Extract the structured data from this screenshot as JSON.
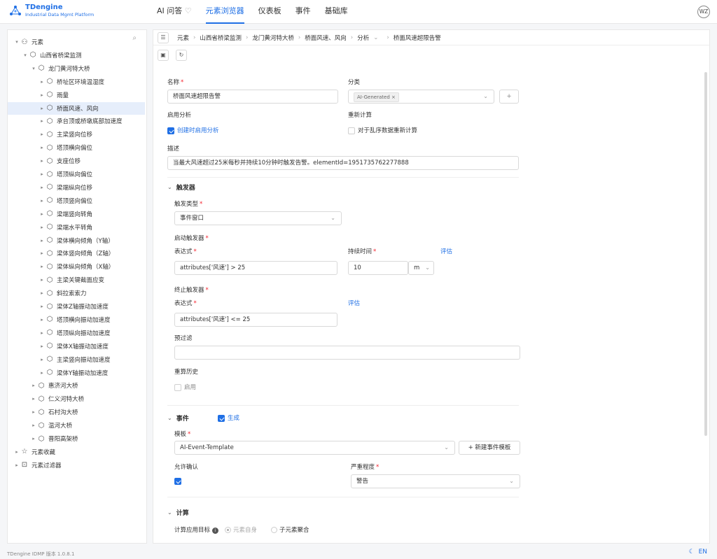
{
  "app": {
    "title": "TDengine",
    "subtitle": "Industrial Data Mgmt Platform",
    "version": "TDengine IDMP 版本 1.0.8.1",
    "lang": "EN",
    "avatar": "WZ"
  },
  "nav": [
    "AI 问答",
    "元素浏览器",
    "仪表板",
    "事件",
    "基础库"
  ],
  "tree": [
    {
      "label": "元素",
      "level": 0,
      "icon": "hierarchy",
      "caret": "▾"
    },
    {
      "label": "山西省桥梁监测",
      "level": 1,
      "icon": "cube",
      "caret": "▾"
    },
    {
      "label": "龙门黄河特大桥",
      "level": 2,
      "icon": "cube",
      "caret": "▾"
    },
    {
      "label": "桥址区环境温湿度",
      "level": 3,
      "icon": "cube",
      "caret": "▸"
    },
    {
      "label": "雨量",
      "level": 3,
      "icon": "cube",
      "caret": "▸"
    },
    {
      "label": "桥面风速、风向",
      "level": 3,
      "icon": "cube",
      "caret": "▸",
      "selected": true
    },
    {
      "label": "承台顶或桥墩底部加速度",
      "level": 3,
      "icon": "cube",
      "caret": "▸"
    },
    {
      "label": "主梁竖向位移",
      "level": 3,
      "icon": "cube",
      "caret": "▸"
    },
    {
      "label": "塔顶横向偏位",
      "level": 3,
      "icon": "cube",
      "caret": "▸"
    },
    {
      "label": "支座位移",
      "level": 3,
      "icon": "cube",
      "caret": "▸"
    },
    {
      "label": "塔顶纵向偏位",
      "level": 3,
      "icon": "cube",
      "caret": "▸"
    },
    {
      "label": "梁端纵向位移",
      "level": 3,
      "icon": "cube",
      "caret": "▸"
    },
    {
      "label": "塔顶竖向偏位",
      "level": 3,
      "icon": "cube",
      "caret": "▸"
    },
    {
      "label": "梁端竖向转角",
      "level": 3,
      "icon": "cube",
      "caret": "▸"
    },
    {
      "label": "梁端水平转角",
      "level": 3,
      "icon": "cube",
      "caret": "▸"
    },
    {
      "label": "梁体横向倾角（Y轴）",
      "level": 3,
      "icon": "cube",
      "caret": "▸"
    },
    {
      "label": "梁体竖向倾角（Z轴）",
      "level": 3,
      "icon": "cube",
      "caret": "▸"
    },
    {
      "label": "梁体纵向倾角（X轴）",
      "level": 3,
      "icon": "cube",
      "caret": "▸"
    },
    {
      "label": "主梁关键截面应变",
      "level": 3,
      "icon": "cube",
      "caret": "▸"
    },
    {
      "label": "斜拉索索力",
      "level": 3,
      "icon": "cube",
      "caret": "▸"
    },
    {
      "label": "梁体Z轴振动加速度",
      "level": 3,
      "icon": "cube",
      "caret": "▸"
    },
    {
      "label": "塔顶横向振动加速度",
      "level": 3,
      "icon": "cube",
      "caret": "▸"
    },
    {
      "label": "塔顶纵向振动加速度",
      "level": 3,
      "icon": "cube",
      "caret": "▸"
    },
    {
      "label": "梁体X轴振动加速度",
      "level": 3,
      "icon": "cube",
      "caret": "▸"
    },
    {
      "label": "主梁竖向振动加速度",
      "level": 3,
      "icon": "cube",
      "caret": "▸"
    },
    {
      "label": "梁体Y轴振动加速度",
      "level": 3,
      "icon": "cube",
      "caret": "▸"
    },
    {
      "label": "惠济河大桥",
      "level": 2,
      "icon": "cube",
      "caret": "▸"
    },
    {
      "label": "仁义河特大桥",
      "level": 2,
      "icon": "cube",
      "caret": "▸"
    },
    {
      "label": "石村沟大桥",
      "level": 2,
      "icon": "cube",
      "caret": "▸"
    },
    {
      "label": "温河大桥",
      "level": 2,
      "icon": "cube",
      "caret": "▸"
    },
    {
      "label": "晋阳高架桥",
      "level": 2,
      "icon": "cube",
      "caret": "▸"
    },
    {
      "label": "元素收藏",
      "level": 0,
      "icon": "star-box",
      "caret": "▸"
    },
    {
      "label": "元素过滤器",
      "level": 0,
      "icon": "filter-box",
      "caret": "▸"
    }
  ],
  "breadcrumb": [
    "元素",
    "山西省桥梁监测",
    "龙门黄河特大桥",
    "桥面风速、风向",
    "分析",
    "桥面风速超限告警"
  ],
  "form": {
    "name_label": "名称",
    "name_value": "桥面风速超限告警",
    "category_label": "分类",
    "category_tag": "AI-Generated",
    "enable_label": "启用分析",
    "enable_check": "创建时启用分析",
    "recalc_label": "重新计算",
    "recalc_check": "对于乱序数据重新计算",
    "desc_label": "描述",
    "desc_value": "当最大风速超过25米每秒并持续10分钟时触发告警。elementId=1951735762277888",
    "trigger_section": "触发器",
    "trigger_type_label": "触发类型",
    "trigger_type_value": "事件窗口",
    "start_trigger_label": "启动触发器",
    "expr_label": "表达式",
    "start_expr": "attributes['风速'] > 25",
    "duration_label": "持续时间",
    "duration_value": "10",
    "duration_unit": "m",
    "evaluate": "评估",
    "stop_trigger_label": "终止触发器",
    "stop_expr": "attributes['风速'] <= 25",
    "prefilter_label": "预过滤",
    "prefilter_value": "",
    "recalc_history_label": "重算历史",
    "recalc_history_check": "启用",
    "event_section": "事件",
    "event_generate": "生成",
    "template_label": "模板",
    "template_value": "AI-Event-Template",
    "new_template": "+ 新建事件模板",
    "allow_ack_label": "允许确认",
    "severity_label": "严重程度",
    "severity_value": "警告",
    "calc_section": "计算",
    "calc_target_label": "计算应用目标",
    "calc_self": "元素自身",
    "calc_child": "子元素聚合"
  }
}
